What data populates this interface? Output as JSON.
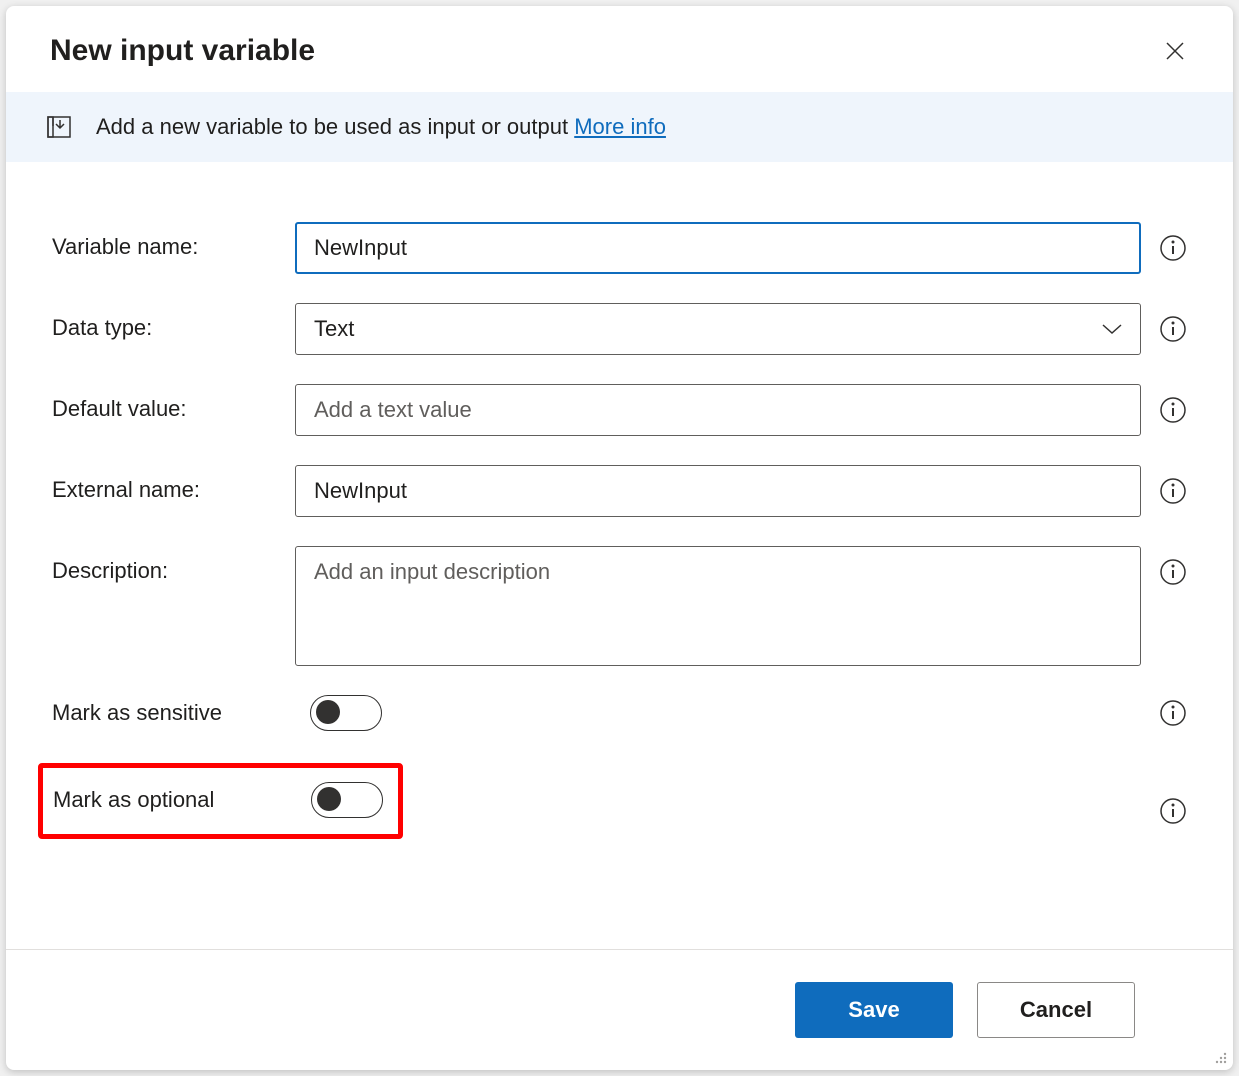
{
  "dialog": {
    "title": "New input variable"
  },
  "banner": {
    "text": "Add a new variable to be used as input or output ",
    "link": "More info"
  },
  "form": {
    "variableName": {
      "label": "Variable name:",
      "value": "NewInput"
    },
    "dataType": {
      "label": "Data type:",
      "value": "Text"
    },
    "defaultValue": {
      "label": "Default value:",
      "placeholder": "Add a text value",
      "value": ""
    },
    "externalName": {
      "label": "External name:",
      "value": "NewInput"
    },
    "description": {
      "label": "Description:",
      "placeholder": "Add an input description",
      "value": ""
    },
    "markSensitive": {
      "label": "Mark as sensitive",
      "value": false
    },
    "markOptional": {
      "label": "Mark as optional",
      "value": false
    }
  },
  "buttons": {
    "save": "Save",
    "cancel": "Cancel"
  }
}
